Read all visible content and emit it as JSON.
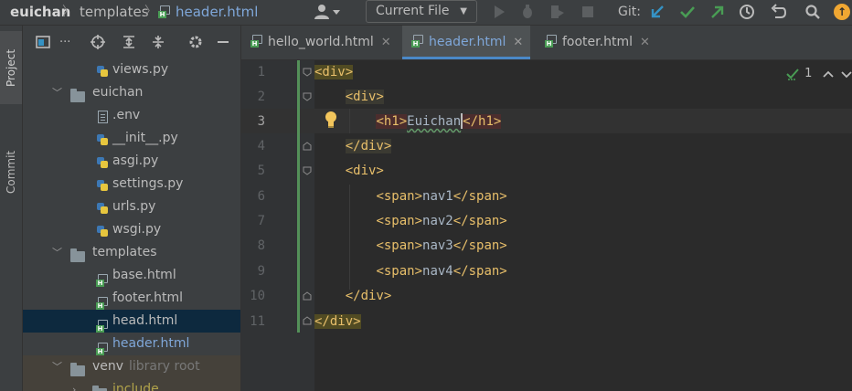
{
  "breadcrumb": {
    "root": "euichan",
    "folder": "templates",
    "file": "header.html",
    "chevron": "〉"
  },
  "toolbar": {
    "run_config": "Current File",
    "git_label": "Git:",
    "icons": [
      "user-icon",
      "run-icon",
      "debug-icon",
      "coverage-icon",
      "stop-icon",
      "git-update-icon",
      "git-commit-icon",
      "git-push-icon",
      "history-icon",
      "rollback-icon",
      "search-icon",
      "ide-update-icon"
    ]
  },
  "left_strip": {
    "project_label": "Project",
    "commit_label": "Commit"
  },
  "project_panel": {
    "title_ellipsis": "...",
    "tree": [
      {
        "label": "views.py",
        "kind": "py",
        "depth": 3
      },
      {
        "label": "euichan",
        "kind": "folder",
        "depth": 2,
        "expanded": true
      },
      {
        "label": ".env",
        "kind": "txt",
        "depth": 3
      },
      {
        "label": "__init__.py",
        "kind": "py",
        "depth": 3
      },
      {
        "label": "asgi.py",
        "kind": "py",
        "depth": 3
      },
      {
        "label": "settings.py",
        "kind": "py",
        "depth": 3
      },
      {
        "label": "urls.py",
        "kind": "py",
        "depth": 3
      },
      {
        "label": "wsgi.py",
        "kind": "py",
        "depth": 3
      },
      {
        "label": "templates",
        "kind": "folder",
        "depth": 2,
        "expanded": true
      },
      {
        "label": "base.html",
        "kind": "html",
        "depth": 3
      },
      {
        "label": "footer.html",
        "kind": "html",
        "depth": 3
      },
      {
        "label": "head.html",
        "kind": "html",
        "depth": 3,
        "selected": true
      },
      {
        "label": "header.html",
        "kind": "html",
        "depth": 3,
        "current": true
      },
      {
        "label": "venv",
        "kind": "folder",
        "depth": 2,
        "expanded": true,
        "suffix": "library root"
      },
      {
        "label": "include",
        "kind": "folder",
        "depth": 3
      }
    ]
  },
  "tabs": [
    {
      "label": "hello_world.html",
      "close": "✕"
    },
    {
      "label": "header.html",
      "close": "✕",
      "active": true
    },
    {
      "label": "footer.html",
      "close": "✕"
    }
  ],
  "editor": {
    "inspection_count": "1",
    "line_numbers": [
      "1",
      "2",
      "3",
      "4",
      "5",
      "6",
      "7",
      "8",
      "9",
      "10",
      "11"
    ],
    "lines": [
      "<div>",
      "    <div>",
      "        <h1>Euichan</h1>",
      "    </div>",
      "    <div>",
      "        <span>nav1</span>",
      "        <span>nav2</span>",
      "        <span>nav3</span>",
      "        <span>nav4</span>",
      "    </div>",
      "</div>"
    ]
  },
  "colors": {
    "tag": "#e8bf6a",
    "text": "#a9b7c6",
    "accent": "#4a88c7",
    "selection": "#0d293e"
  }
}
